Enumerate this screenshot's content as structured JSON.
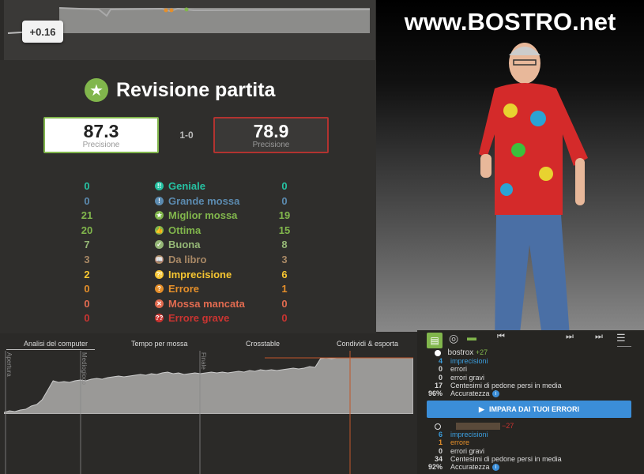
{
  "eval_badge": "+0.16",
  "site": "www.BOSTRO.net",
  "review": {
    "title": "Revisione partita",
    "white_accuracy": "87.3",
    "black_accuracy": "78.9",
    "accuracy_label": "Precisione",
    "result": "1-0"
  },
  "stats": [
    {
      "label": "Geniale",
      "white": "0",
      "black": "0",
      "color": "#26c2a3",
      "icon": "!!"
    },
    {
      "label": "Grande mossa",
      "white": "0",
      "black": "0",
      "color": "#5c8bb0",
      "icon": "!"
    },
    {
      "label": "Miglior mossa",
      "white": "21",
      "black": "19",
      "color": "#81b64c",
      "icon": "★"
    },
    {
      "label": "Ottima",
      "white": "20",
      "black": "15",
      "color": "#81b64c",
      "icon": "👍"
    },
    {
      "label": "Buona",
      "white": "7",
      "black": "8",
      "color": "#95b776",
      "icon": "✓"
    },
    {
      "label": "Da libro",
      "white": "3",
      "black": "3",
      "color": "#a88865",
      "icon": "📖"
    },
    {
      "label": "Imprecisione",
      "white": "2",
      "black": "6",
      "color": "#f7c631",
      "icon": "?!"
    },
    {
      "label": "Errore",
      "white": "0",
      "black": "1",
      "color": "#e58f2a",
      "icon": "?"
    },
    {
      "label": "Mossa mancata",
      "white": "0",
      "black": "0",
      "color": "#e26b50",
      "icon": "✕"
    },
    {
      "label": "Errore grave",
      "white": "0",
      "black": "0",
      "color": "#ca3431",
      "icon": "??"
    }
  ],
  "tabs": [
    "Analisi del computer",
    "Tempo per mossa",
    "Crosstable",
    "Condividi & esporta"
  ],
  "phases": [
    "Apertura",
    "Mediogioco",
    "Finale"
  ],
  "graph_points": [
    2,
    4,
    3,
    5,
    6,
    10,
    12,
    18,
    30,
    42,
    40,
    41,
    40,
    42,
    43,
    42,
    44,
    45,
    44,
    46,
    47,
    48,
    47,
    48,
    49,
    50,
    49,
    51,
    50,
    52,
    53,
    51,
    52,
    50,
    51,
    52,
    51,
    52,
    53,
    52,
    53,
    52,
    53,
    54,
    53,
    55,
    54,
    56,
    55,
    56,
    55,
    56,
    57,
    58,
    57,
    58,
    60,
    59,
    70,
    71,
    70,
    71,
    71,
    71,
    71,
    71,
    71,
    71,
    71,
    71,
    71,
    71,
    71,
    71,
    71,
    71
  ],
  "moves_panel": {
    "player1": "bostrox",
    "player1_delta": "+27",
    "player1_stats": [
      {
        "num": "4",
        "text": "imprecisioni",
        "color": "#3b9ede"
      },
      {
        "num": "0",
        "text": "errori",
        "color": "#ddd"
      },
      {
        "num": "0",
        "text": "errori gravi",
        "color": "#ddd"
      },
      {
        "num": "17",
        "text": "Centesimi di pedone persi in media",
        "color": "#ddd"
      },
      {
        "num": "96%",
        "text": "Accuratezza",
        "color": "#ddd"
      }
    ],
    "learn_button": "IMPARA DAI TUOI ERRORI",
    "player2_delta": "−27",
    "player2_stats": [
      {
        "num": "6",
        "text": "imprecisioni",
        "color": "#3b9ede"
      },
      {
        "num": "1",
        "text": "errore",
        "color": "#e58f2a"
      },
      {
        "num": "0",
        "text": "errori gravi",
        "color": "#ddd"
      },
      {
        "num": "34",
        "text": "Centesimi di pedone persi in media",
        "color": "#ddd"
      },
      {
        "num": "92%",
        "text": "Accuratezza",
        "color": "#ddd"
      }
    ]
  }
}
